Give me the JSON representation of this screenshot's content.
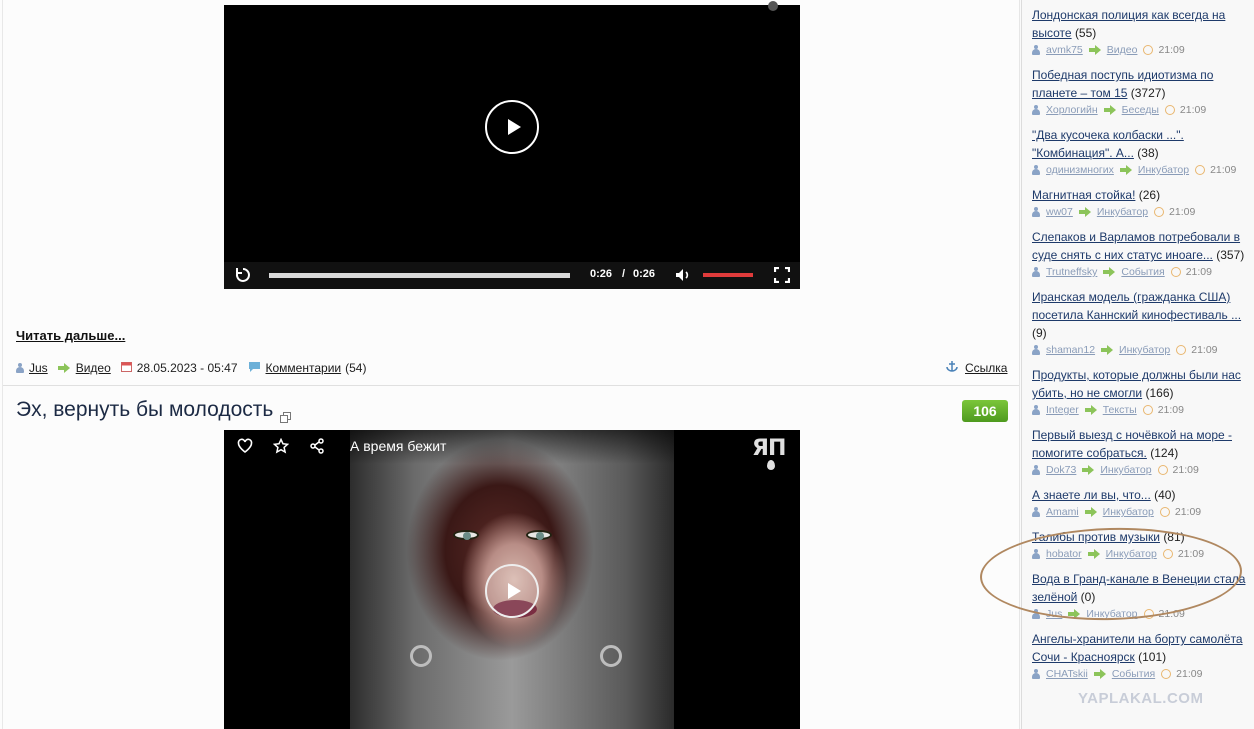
{
  "video1": {
    "time_current": "0:26",
    "time_separator": "/",
    "time_total": "0:26"
  },
  "post1": {
    "read_more": "Читать дальше...",
    "author": "Jus",
    "category": "Видео",
    "date": "28.05.2023 - 05:47",
    "comments_label": "Комментарии",
    "comments_count": "(54)",
    "link_label": "Ссылка"
  },
  "post2": {
    "title": "Эх, вернуть бы молодость",
    "rating": "106",
    "video_title": "А время бежит",
    "logo_text": "ЯП"
  },
  "sidebar": {
    "items": [
      {
        "title": "Лондонская полиция как всегда на высоте",
        "count": "(55)",
        "user": "avmk75",
        "category": "Видео",
        "time": "21:09"
      },
      {
        "title": "Победная поступь идиотизма по планете – том 15",
        "count": "(3727)",
        "user": "Хорлогийн",
        "category": "Беседы",
        "time": "21:09"
      },
      {
        "title": "\"Два кусочека колбаски ...\". \"Комбинация\". А...",
        "count": "(38)",
        "user": "одинизмногих",
        "category": "Инкубатор",
        "time": "21:09"
      },
      {
        "title": "Магнитная стойка!",
        "count": "(26)",
        "user": "ww07",
        "category": "Инкубатор",
        "time": "21:09"
      },
      {
        "title": "Слепаков и Варламов потребовали в суде снять с них статус иноаге...",
        "count": "(357)",
        "user": "Trutneffsky",
        "category": "События",
        "time": "21:09"
      },
      {
        "title": "Иранская модель (гражданка США) посетила Каннский кинофестиваль ...",
        "count": "(9)",
        "user": "shaman12",
        "category": "Инкубатор",
        "time": "21:09"
      },
      {
        "title": "Продукты, которые должны были нас убить, но не смогли",
        "count": "(166)",
        "user": "Integer",
        "category": "Тексты",
        "time": "21:09"
      },
      {
        "title": "Первый выезд с ночёвкой на море - помогите собраться.",
        "count": "(124)",
        "user": "Dok73",
        "category": "Инкубатор",
        "time": "21:09"
      },
      {
        "title": "А знаете ли вы, что...",
        "count": "(40)",
        "user": "Amami",
        "category": "Инкубатор",
        "time": "21:09"
      },
      {
        "title": "Талибы против музыки",
        "count": "(81)",
        "user": "hobator",
        "category": "Инкубатор",
        "time": "21:09"
      },
      {
        "title": "Вода в Гранд-канале в Венеции стала зелёной",
        "count": "(0)",
        "user": "Jus",
        "category": "Инкубатор",
        "time": "21:09"
      },
      {
        "title": "Ангелы-хранители на борту самолёта Сочи - Красноярск",
        "count": "(101)",
        "user": "CHATskii",
        "category": "События",
        "time": "21:09"
      }
    ]
  },
  "watermark": "YAPLAKAL.COM"
}
